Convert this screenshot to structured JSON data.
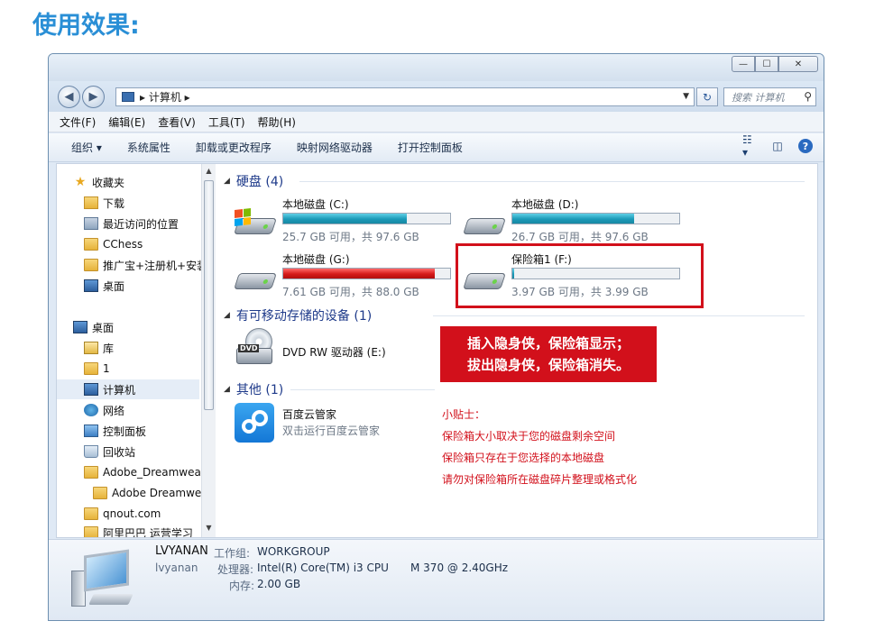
{
  "page_title": "使用效果:",
  "window": {
    "buttons": {
      "minimize": "—",
      "maximize": "☐",
      "close": "✕"
    }
  },
  "address": {
    "path": "▸ 计算机 ▸",
    "search_placeholder": "搜索 计算机"
  },
  "menu": [
    "文件(F)",
    "编辑(E)",
    "查看(V)",
    "工具(T)",
    "帮助(H)"
  ],
  "toolbar": {
    "organize": "组织 ▾",
    "items": [
      "系统属性",
      "卸载或更改程序",
      "映射网络驱动器",
      "打开控制面板"
    ],
    "help": "?"
  },
  "sidebar": {
    "favorites": "收藏夹",
    "favorite_items": [
      "下载",
      "最近访问的位置",
      "CChess",
      "推广宝+注册机+安装",
      "桌面"
    ],
    "desktop": "桌面",
    "desktop_items": [
      "库",
      "1",
      "计算机",
      "网络",
      "控制面板",
      "回收站",
      "Adobe_Dreamweaver",
      "Adobe Dreamweaver",
      "qnout.com",
      "阿里巴巴 运营学习"
    ]
  },
  "groups": {
    "hdd": "硬盘 (4)",
    "removable": "有可移动存储的设备 (1)",
    "other": "其他 (1)"
  },
  "drives": [
    {
      "name": "本地磁盘 (C:)",
      "info": "25.7 GB 可用，共 97.6 GB",
      "used_fraction": 0.74,
      "color": "#1b9ab8"
    },
    {
      "name": "本地磁盘 (D:)",
      "info": "26.7 GB 可用，共 97.6 GB",
      "used_fraction": 0.73,
      "color": "#1b9ab8"
    },
    {
      "name": "本地磁盘 (G:)",
      "info": "7.61 GB 可用，共 88.0 GB",
      "used_fraction": 0.91,
      "color": "#d51a1a"
    },
    {
      "name": "保险箱1 (F:)",
      "info": "3.97 GB 可用，共 3.99 GB",
      "used_fraction": 0.01,
      "color": "#1b9ab8"
    }
  ],
  "dvd": {
    "label": "DVD",
    "name": "DVD RW 驱动器 (E:)"
  },
  "callout": {
    "line1": "插入隐身侠，保险箱显示；",
    "line2": "拔出隐身侠，保险箱消失。"
  },
  "baidu": {
    "name": "百度云管家",
    "desc": "双击运行百度云管家"
  },
  "tips": {
    "title": "小贴士：",
    "lines": [
      "保险箱大小取决于您的磁盘剩余空间",
      "保险箱只存在于您选择的本地磁盘",
      "请勿对保险箱所在磁盘碎片整理或格式化"
    ]
  },
  "details": {
    "computer_name": "LVYANAN",
    "workgroup_label": "工作组:",
    "workgroup": "WORKGROUP",
    "user": "lvyanan",
    "cpu_label": "处理器:",
    "cpu": "Intel(R) Core(TM) i3 CPU",
    "cpu_model": "M 370  @ 2.40GHz",
    "mem_label": "内存:",
    "mem": "2.00 GB"
  },
  "colors": {
    "accent": "#2a8fd6",
    "highlight": "#d2101b",
    "bar": "#1b9ab8",
    "bar_full": "#d51a1a"
  }
}
